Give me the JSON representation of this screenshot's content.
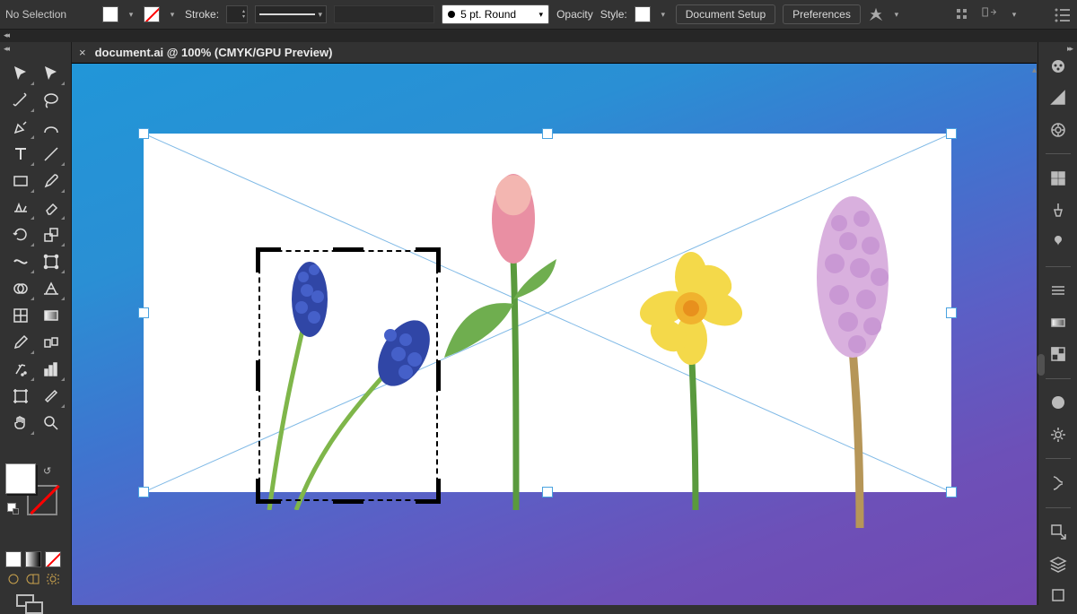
{
  "topbar": {
    "selection_status": "No Selection",
    "stroke_label": "Stroke:",
    "brush_label": "5 pt. Round",
    "opacity_label": "Opacity",
    "style_label": "Style:",
    "doc_setup_label": "Document Setup",
    "preferences_label": "Preferences"
  },
  "document": {
    "close_glyph": "×",
    "title": "document.ai @ 100% (CMYK/GPU Preview)"
  },
  "left_tools": [
    "selection-tool",
    "direct-selection-tool",
    "magic-wand-tool",
    "lasso-tool",
    "pen-tool",
    "curvature-tool",
    "type-tool",
    "line-segment-tool",
    "rectangle-tool",
    "paintbrush-tool",
    "shaper-tool",
    "eraser-tool",
    "rotate-tool",
    "scale-tool",
    "width-tool",
    "free-transform-tool",
    "shape-builder-tool",
    "perspective-grid-tool",
    "mesh-tool",
    "gradient-tool",
    "eyedropper-tool",
    "blend-tool",
    "symbol-sprayer-tool",
    "column-graph-tool",
    "artboard-tool",
    "slice-tool",
    "hand-tool",
    "zoom-tool"
  ],
  "right_panels": [
    "properties-panel",
    "color-panel",
    "color-guide-panel",
    "swatches-panel",
    "brushes-panel",
    "symbols-panel",
    "stroke-panel",
    "gradient-panel",
    "transparency-panel",
    "appearance-panel",
    "graphic-styles-panel",
    "layers-panel",
    "asset-export-panel",
    "artboards-panel",
    "libraries-panel"
  ],
  "canvas": {
    "flowers": [
      "grape-hyacinth",
      "tulip",
      "daffodil",
      "hyacinth"
    ]
  },
  "colors": {
    "topbar_bg": "#323232",
    "fill": "#ffffff",
    "stroke": "none",
    "gradient_start": "#2196d8",
    "gradient_end": "#7248af"
  }
}
